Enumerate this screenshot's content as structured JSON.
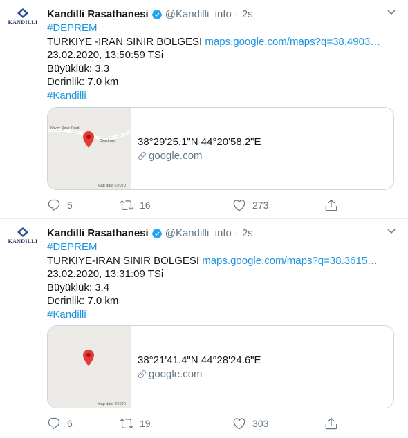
{
  "tweets": [
    {
      "author_name": "Kandilli Rasathanesi",
      "handle": "@Kandilli_info",
      "dot": "·",
      "time": "2s",
      "hashtag_top": "#DEPREM",
      "region": "TURKIYE -IRAN SINIR BOLGESI",
      "map_link": "maps.google.com/maps?q=38.4903…",
      "datetime": "23.02.2020, 13:50:59 TSi",
      "magnitude": "Büyüklük: 3.3",
      "depth": "Derinlik: 7.0 km",
      "hashtag_bottom": "#Kandilli",
      "card": {
        "coords": "38°29'25.1\"N 44°20'58.2\"E",
        "domain": "google.com",
        "map_data": "Map data ©2020",
        "road_label_1": "Khvoy-Qotur Road",
        "road_label_2": "Chaldiyan"
      },
      "replies": "5",
      "retweets": "16",
      "likes": "273"
    },
    {
      "author_name": "Kandilli Rasathanesi",
      "handle": "@Kandilli_info",
      "dot": "·",
      "time": "2s",
      "hashtag_top": "#DEPREM",
      "region": "TURKIYE-IRAN SINIR BOLGESI",
      "map_link": "maps.google.com/maps?q=38.3615…",
      "datetime": "23.02.2020, 13:31:09 TSi",
      "magnitude": "Büyüklük: 3.4",
      "depth": "Derinlik: 7.0 km",
      "hashtag_bottom": "#Kandilli",
      "card": {
        "coords": "38°21'41.4\"N 44°28'24.6\"E",
        "domain": "google.com",
        "map_data": "Map data ©2020"
      },
      "replies": "6",
      "retweets": "19",
      "likes": "303"
    }
  ],
  "avatar": {
    "logo_text": "KANDILLI"
  },
  "colors": {
    "link": "#1b95e0",
    "secondary": "#657786",
    "pin": "#e53935",
    "verified": "#1da1f2"
  },
  "icons": [
    "verified-badge-icon",
    "chevron-down-icon",
    "map-pin-icon",
    "link-icon",
    "reply-icon",
    "retweet-icon",
    "like-icon",
    "share-icon"
  ]
}
